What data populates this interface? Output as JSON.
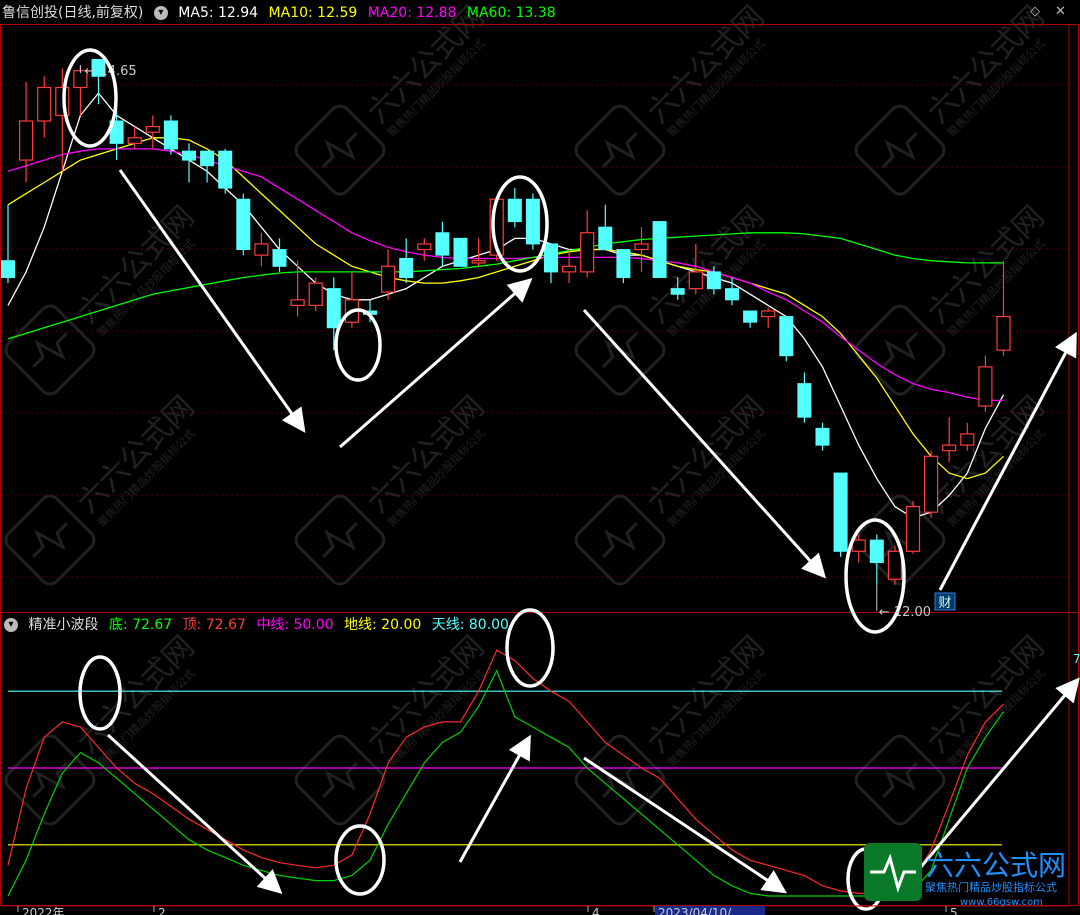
{
  "main_header": {
    "stock_title": "鲁信创投(日线,前复权)",
    "ma5": "MA5: 12.94",
    "ma10": "MA10: 12.59",
    "ma20": "MA20: 12.88",
    "ma60": "MA60: 13.38"
  },
  "sub_header": {
    "indicator_title": "精准小波段",
    "bottom": "底: 72.67",
    "top": "顶: 72.67",
    "mid": "中线: 50.00",
    "ground": "地线: 20.00",
    "sky": "天线: 80.00"
  },
  "annotations": {
    "high_label": "14.65",
    "low_label": "12.00",
    "cai_badge": "财",
    "right_value_label": "7"
  },
  "date_axis": {
    "labels": [
      "2022年",
      "2",
      "4",
      "2023/04/10/",
      "5"
    ]
  },
  "watermark": {
    "brand": "六六公式网",
    "slogan": "聚焦热门精品炒股指标公式",
    "url": "www.66gsw.com"
  },
  "colors": {
    "up": "#ff3c3c",
    "down": "#54ffff",
    "ma5": "#ffffff",
    "ma10": "#ffff00",
    "ma20": "#ff00ff",
    "ma60": "#00ff00",
    "sky_line": "#54ffff",
    "mid_line": "#ff00ff",
    "ground_line": "#ffff00",
    "frame": "#b00000"
  },
  "chart_data": [
    {
      "type": "candlestick",
      "title": "鲁信创投(日线,前复权)",
      "candles": [
        {
          "o": 12.9,
          "h": 13.4,
          "l": 12.7,
          "c": 12.75
        },
        {
          "o": 13.8,
          "h": 14.5,
          "l": 13.6,
          "c": 14.15
        },
        {
          "o": 14.15,
          "h": 14.55,
          "l": 14.0,
          "c": 14.45
        },
        {
          "o": 14.2,
          "h": 14.62,
          "l": 13.7,
          "c": 14.45
        },
        {
          "o": 14.45,
          "h": 14.65,
          "l": 14.2,
          "c": 14.6
        },
        {
          "o": 14.7,
          "h": 14.7,
          "l": 14.3,
          "c": 14.55
        },
        {
          "o": 14.15,
          "h": 14.4,
          "l": 13.8,
          "c": 13.95
        },
        {
          "o": 13.95,
          "h": 14.1,
          "l": 13.9,
          "c": 14.0
        },
        {
          "o": 14.05,
          "h": 14.2,
          "l": 13.9,
          "c": 14.1
        },
        {
          "o": 14.15,
          "h": 14.2,
          "l": 13.85,
          "c": 13.9
        },
        {
          "o": 13.88,
          "h": 13.95,
          "l": 13.6,
          "c": 13.8
        },
        {
          "o": 13.88,
          "h": 13.88,
          "l": 13.6,
          "c": 13.75
        },
        {
          "o": 13.88,
          "h": 13.9,
          "l": 13.5,
          "c": 13.55
        },
        {
          "o": 13.45,
          "h": 13.5,
          "l": 12.95,
          "c": 13.0
        },
        {
          "o": 12.95,
          "h": 13.15,
          "l": 12.85,
          "c": 13.05
        },
        {
          "o": 13.0,
          "h": 13.1,
          "l": 12.8,
          "c": 12.85
        },
        {
          "o": 12.5,
          "h": 12.9,
          "l": 12.4,
          "c": 12.55
        },
        {
          "o": 12.5,
          "h": 12.75,
          "l": 12.45,
          "c": 12.7
        },
        {
          "o": 12.65,
          "h": 12.75,
          "l": 12.1,
          "c": 12.3
        },
        {
          "o": 12.35,
          "h": 12.8,
          "l": 12.3,
          "c": 12.55
        },
        {
          "o": 12.45,
          "h": 12.55,
          "l": 12.35,
          "c": 12.42
        },
        {
          "o": 12.62,
          "h": 13.0,
          "l": 12.55,
          "c": 12.85
        },
        {
          "o": 12.92,
          "h": 13.1,
          "l": 12.7,
          "c": 12.75
        },
        {
          "o": 13.0,
          "h": 13.1,
          "l": 12.9,
          "c": 13.05
        },
        {
          "o": 13.15,
          "h": 13.25,
          "l": 12.85,
          "c": 12.95
        },
        {
          "o": 13.1,
          "h": 13.1,
          "l": 12.85,
          "c": 12.85
        },
        {
          "o": 12.88,
          "h": 13.1,
          "l": 12.85,
          "c": 12.9
        },
        {
          "o": 12.95,
          "h": 13.45,
          "l": 12.9,
          "c": 13.45
        },
        {
          "o": 13.45,
          "h": 13.55,
          "l": 13.2,
          "c": 13.25
        },
        {
          "o": 13.45,
          "h": 13.5,
          "l": 13.0,
          "c": 13.05
        },
        {
          "o": 13.05,
          "h": 13.05,
          "l": 12.7,
          "c": 12.8
        },
        {
          "o": 12.8,
          "h": 13.0,
          "l": 12.7,
          "c": 12.85
        },
        {
          "o": 12.8,
          "h": 13.35,
          "l": 12.75,
          "c": 13.15
        },
        {
          "o": 13.2,
          "h": 13.4,
          "l": 13.0,
          "c": 13.0
        },
        {
          "o": 13.0,
          "h": 13.0,
          "l": 12.7,
          "c": 12.75
        },
        {
          "o": 13.0,
          "h": 13.2,
          "l": 12.8,
          "c": 13.05
        },
        {
          "o": 13.25,
          "h": 13.25,
          "l": 12.75,
          "c": 12.75
        },
        {
          "o": 12.65,
          "h": 12.75,
          "l": 12.55,
          "c": 12.6
        },
        {
          "o": 12.65,
          "h": 13.05,
          "l": 12.6,
          "c": 12.8
        },
        {
          "o": 12.8,
          "h": 12.85,
          "l": 12.6,
          "c": 12.65
        },
        {
          "o": 12.65,
          "h": 12.75,
          "l": 12.5,
          "c": 12.55
        },
        {
          "o": 12.45,
          "h": 12.45,
          "l": 12.3,
          "c": 12.35
        },
        {
          "o": 12.4,
          "h": 12.48,
          "l": 12.3,
          "c": 12.45
        },
        {
          "o": 12.4,
          "h": 12.4,
          "l": 12.0,
          "c": 12.05
        },
        {
          "o": 11.8,
          "h": 11.9,
          "l": 11.45,
          "c": 11.5
        },
        {
          "o": 11.4,
          "h": 11.45,
          "l": 11.2,
          "c": 11.25
        },
        {
          "o": 11.0,
          "h": 11.0,
          "l": 10.25,
          "c": 10.3
        },
        {
          "o": 10.3,
          "h": 10.45,
          "l": 10.2,
          "c": 10.4
        },
        {
          "o": 10.4,
          "h": 10.45,
          "l": 10.0,
          "c": 10.2
        },
        {
          "o": 10.05,
          "h": 10.35,
          "l": 10.0,
          "c": 10.3
        },
        {
          "o": 10.3,
          "h": 10.75,
          "l": 10.28,
          "c": 10.7
        },
        {
          "o": 10.65,
          "h": 11.2,
          "l": 10.6,
          "c": 11.15
        },
        {
          "o": 11.2,
          "h": 11.5,
          "l": 11.1,
          "c": 11.25
        },
        {
          "o": 11.25,
          "h": 11.45,
          "l": 11.2,
          "c": 11.35
        },
        {
          "o": 11.6,
          "h": 12.05,
          "l": 11.55,
          "c": 11.95
        },
        {
          "o": 12.1,
          "h": 12.9,
          "l": 12.05,
          "c": 12.4
        }
      ],
      "ma_series": [
        {
          "name": "MA5",
          "values": [
            12.5,
            12.8,
            13.2,
            13.7,
            14.2,
            14.4,
            14.2,
            14.1,
            14.0,
            13.9,
            13.8,
            13.7,
            13.55,
            13.4,
            13.2,
            13.0,
            12.85,
            12.7,
            12.6,
            12.55,
            12.55,
            12.6,
            12.65,
            12.75,
            12.85,
            12.9,
            12.95,
            13.0,
            13.1,
            13.1,
            13.05,
            13.0,
            13.0,
            13.0,
            12.95,
            12.95,
            12.9,
            12.85,
            12.8,
            12.75,
            12.7,
            12.6,
            12.5,
            12.4,
            12.2,
            11.95,
            11.6,
            11.25,
            10.95,
            10.7,
            10.6,
            10.65,
            10.8,
            11.0,
            11.4,
            11.7
          ]
        },
        {
          "name": "MA10",
          "values": [
            13.4,
            13.5,
            13.6,
            13.7,
            13.8,
            13.85,
            13.9,
            13.95,
            14.0,
            14.0,
            13.98,
            13.9,
            13.8,
            13.65,
            13.5,
            13.35,
            13.2,
            13.05,
            12.95,
            12.85,
            12.8,
            12.75,
            12.72,
            12.7,
            12.7,
            12.72,
            12.75,
            12.8,
            12.85,
            12.9,
            12.95,
            12.98,
            13.0,
            13.0,
            12.98,
            12.95,
            12.9,
            12.85,
            12.82,
            12.8,
            12.75,
            12.7,
            12.65,
            12.6,
            12.5,
            12.4,
            12.25,
            12.05,
            11.85,
            11.6,
            11.35,
            11.15,
            11.0,
            10.95,
            11.0,
            11.15
          ]
        },
        {
          "name": "MA20",
          "values": [
            13.7,
            13.75,
            13.8,
            13.85,
            13.88,
            13.9,
            13.9,
            13.9,
            13.9,
            13.88,
            13.85,
            13.8,
            13.75,
            13.7,
            13.65,
            13.55,
            13.45,
            13.35,
            13.25,
            13.15,
            13.08,
            13.02,
            12.98,
            12.95,
            12.93,
            12.92,
            12.92,
            12.92,
            12.92,
            12.93,
            12.93,
            12.93,
            12.93,
            12.93,
            12.93,
            12.92,
            12.9,
            12.88,
            12.85,
            12.8,
            12.75,
            12.7,
            12.62,
            12.55,
            12.45,
            12.35,
            12.22,
            12.1,
            11.98,
            11.88,
            11.8,
            11.75,
            11.72,
            11.68,
            11.65,
            11.65
          ]
        },
        {
          "name": "MA60",
          "values": [
            12.2,
            12.25,
            12.3,
            12.35,
            12.4,
            12.45,
            12.5,
            12.55,
            12.6,
            12.63,
            12.66,
            12.69,
            12.72,
            12.75,
            12.77,
            12.79,
            12.8,
            12.8,
            12.8,
            12.8,
            12.8,
            12.8,
            12.8,
            12.81,
            12.82,
            12.83,
            12.85,
            12.87,
            12.9,
            12.93,
            12.96,
            12.99,
            13.02,
            13.05,
            13.07,
            13.09,
            13.1,
            13.11,
            13.12,
            13.13,
            13.14,
            13.15,
            13.15,
            13.15,
            13.14,
            13.12,
            13.1,
            13.05,
            13.0,
            12.95,
            12.92,
            12.9,
            12.89,
            12.88,
            12.88,
            12.88
          ]
        }
      ],
      "ylim": [
        9.9,
        15.0
      ],
      "marked_high": 14.65,
      "marked_low": 12.0
    },
    {
      "type": "line",
      "title": "精准小波段",
      "ylim": [
        0,
        100
      ],
      "reference_lines": [
        {
          "name": "天线",
          "value": 80
        },
        {
          "name": "中线",
          "value": 50
        },
        {
          "name": "地线",
          "value": 20
        }
      ],
      "series": [
        {
          "name": "顶",
          "values": [
            12,
            42,
            62,
            68,
            66,
            58,
            50,
            44,
            40,
            35,
            30,
            26,
            22,
            18,
            15,
            13,
            12,
            11,
            12,
            16,
            32,
            52,
            62,
            66,
            68,
            68,
            80,
            96,
            92,
            85,
            80,
            76,
            68,
            60,
            55,
            50,
            46,
            38,
            30,
            24,
            18,
            14,
            12,
            10,
            8,
            4,
            2,
            1,
            1,
            2,
            6,
            18,
            36,
            55,
            68,
            75
          ]
        },
        {
          "name": "底",
          "values": [
            0,
            14,
            32,
            48,
            56,
            52,
            46,
            40,
            34,
            28,
            22,
            18,
            15,
            12,
            10,
            8,
            7,
            6,
            6,
            8,
            14,
            28,
            40,
            52,
            60,
            64,
            74,
            88,
            70,
            66,
            62,
            58,
            50,
            44,
            38,
            32,
            26,
            20,
            14,
            8,
            4,
            1,
            0,
            0,
            0,
            0,
            0,
            0,
            0,
            0,
            2,
            10,
            30,
            50,
            62,
            72
          ]
        }
      ]
    }
  ]
}
